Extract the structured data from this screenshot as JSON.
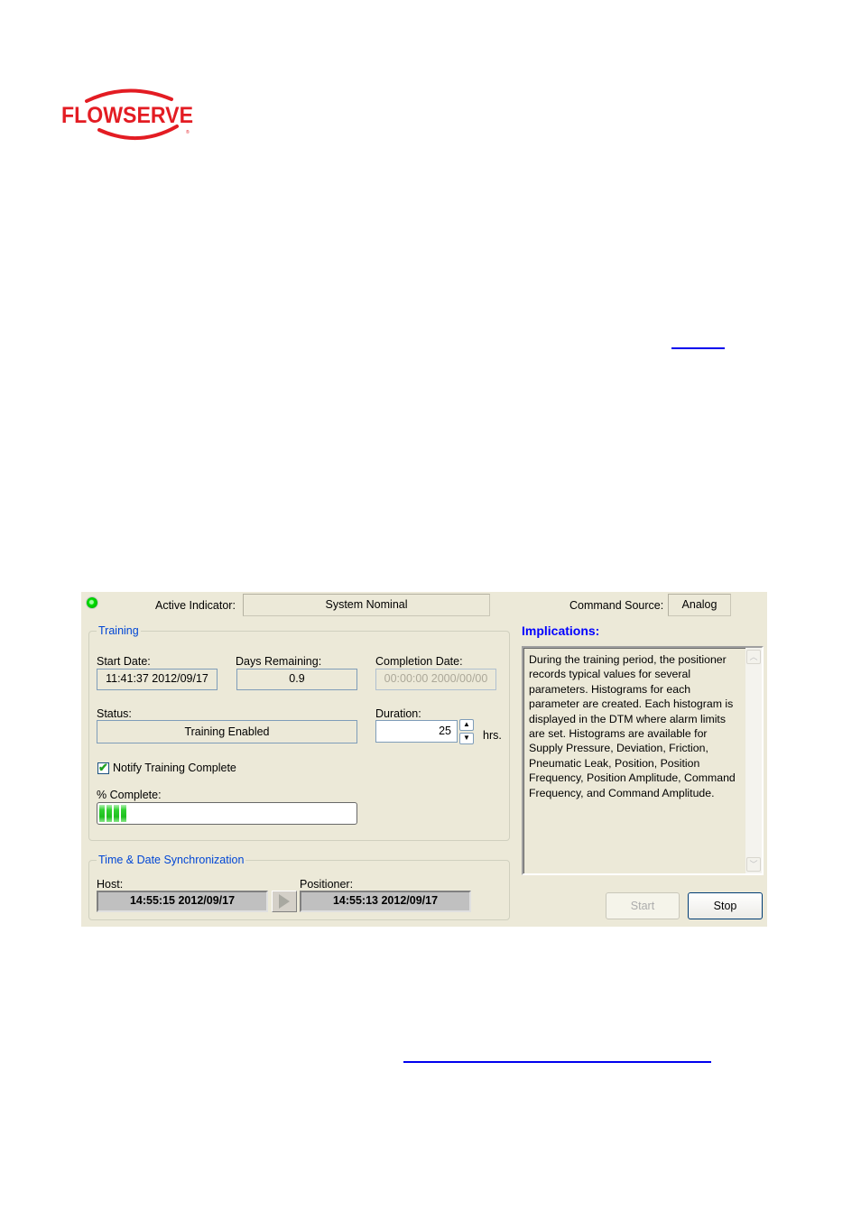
{
  "logo": {
    "brand": "FLOWSERVE",
    "color": "#e31c23"
  },
  "page_links": [
    {
      "name": "inline-link-1",
      "text": ""
    },
    {
      "name": "inline-link-2",
      "text": ""
    }
  ],
  "panel": {
    "active_indicator": {
      "label": "Active Indicator:",
      "value": "System Nominal",
      "led_color": "#00e000",
      "icon": "status-led-icon"
    },
    "command_source": {
      "label": "Command Source:",
      "value": "Analog"
    },
    "training": {
      "legend": "Training",
      "start_date": {
        "label": "Start Date:",
        "value": "11:41:37 2012/09/17"
      },
      "days_remaining": {
        "label": "Days Remaining:",
        "value": "0.9"
      },
      "completion_date": {
        "label": "Completion Date:",
        "value": "00:00:00 2000/00/00"
      },
      "status": {
        "label": "Status:",
        "value": "Training Enabled"
      },
      "duration": {
        "label": "Duration:",
        "value": "25",
        "unit": "hrs.",
        "up_icon": "▲",
        "down_icon": "▼"
      },
      "notify": {
        "label": "Notify Training Complete",
        "checked": true,
        "check_glyph": "✔"
      },
      "percent_complete": {
        "label": "% Complete:",
        "value_percent": 14,
        "segments": 4
      }
    },
    "implications": {
      "title": "Implications:",
      "text": "During the training period, the positioner records typical values for several parameters.  Histograms for each parameter are created.  Each histogram is displayed in the DTM where alarm limits are set.  Histograms are available for Supply Pressure, Deviation, Friction, Pneumatic Leak, Position, Position Frequency, Position Amplitude, Command Frequency, and Command Amplitude.",
      "scroll_up_icon": "︿",
      "scroll_down_icon": "﹀"
    },
    "sync": {
      "legend": "Time & Date Synchronization",
      "host": {
        "label": "Host:",
        "value": "14:55:15 2012/09/17"
      },
      "positioner": {
        "label": "Positioner:",
        "value": "14:55:13 2012/09/17"
      }
    },
    "buttons": {
      "start": "Start",
      "stop": "Stop"
    }
  }
}
